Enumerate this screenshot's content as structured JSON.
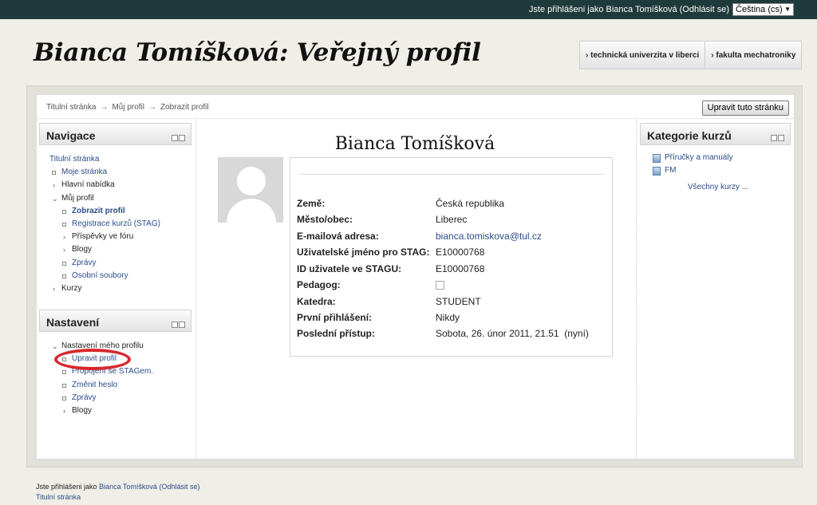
{
  "topbar": {
    "login_prefix": "Jste přihlášeni jako Bianca Tomíšková (Odhlásit se)",
    "language": "Čeština (cs)"
  },
  "header": {
    "title": "Bianca Tomíšková: Veřejný profil",
    "links": [
      "technická univerzita v liberci",
      "fakulta mechatroniky"
    ]
  },
  "breadcrumb": [
    "Titulní stránka",
    "Můj profil",
    "Zobrazit profil"
  ],
  "edit_button": "Upravit tuto stránku",
  "navigace": {
    "title": "Navigace",
    "items": [
      "Titulní stránka",
      "Moje stránka",
      "Hlavní nabídka",
      "Můj profil",
      "Zobrazit profil",
      "Registrace kurzů (STAG)",
      "Příspěvky ve fóru",
      "Blogy",
      "Zprávy",
      "Osobní soubory",
      "Kurzy"
    ]
  },
  "nastaveni": {
    "title": "Nastavení",
    "items": [
      "Nastavení mého profilu",
      "Upravit profil",
      "Propojení se STAGem.",
      "Změnit heslo",
      "Zprávy",
      "Blogy"
    ]
  },
  "profile": {
    "name": "Bianca Tomíšková",
    "fields": [
      {
        "label": "Země:",
        "value": "Česká republika"
      },
      {
        "label": "Město/obec:",
        "value": "Liberec"
      },
      {
        "label": "E-mailová adresa:",
        "value": "bianca.tomiskova@tul.cz"
      },
      {
        "label": "Uživatelské jméno pro STAG:",
        "value": "E10000768"
      },
      {
        "label": "ID uživatele ve STAGU:",
        "value": "E10000768"
      },
      {
        "label": "Pedagog:",
        "value": ""
      },
      {
        "label": "Katedra:",
        "value": "STUDENT"
      },
      {
        "label": "První přihlášení:",
        "value": "Nikdy"
      },
      {
        "label": "Poslední přístup:",
        "value": "Sobota, 26. únor 2011, 21.51  (nyní)"
      }
    ]
  },
  "kategorie": {
    "title": "Kategorie kurzů",
    "items": [
      "Příručky a manuály",
      "FM"
    ],
    "all": "Všechny kurzy ..."
  },
  "footer": {
    "prefix": "Jste přihlášeni jako",
    "user": "Bianca Tomíšková",
    "logout": "(Odhlásit se)",
    "home": "Titulní stránka"
  },
  "colors": {
    "topbar": "#1f3a3a",
    "link": "#2b4c8a",
    "highlight_circle": "#d7282e"
  }
}
